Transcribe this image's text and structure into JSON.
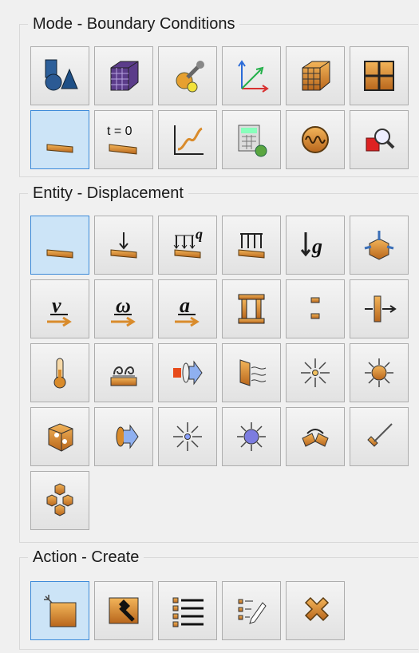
{
  "mode_group": {
    "title": "Mode - Boundary Conditions",
    "buttons": [
      {
        "icon": "geometry-shapes-icon"
      },
      {
        "icon": "mesh-cube-icon"
      },
      {
        "icon": "tools-properties-icon"
      },
      {
        "icon": "coordinate-system-icon"
      },
      {
        "icon": "mesh-grid-cube-icon"
      },
      {
        "icon": "panel-grid-icon"
      },
      {
        "icon": "boundary-conditions-icon",
        "selected": true
      },
      {
        "icon": "initial-conditions-icon",
        "label": "t = 0"
      },
      {
        "icon": "curve-plot-icon"
      },
      {
        "icon": "calculator-gear-icon"
      },
      {
        "icon": "vibration-wave-icon"
      },
      {
        "icon": "inspect-magnifier-icon"
      }
    ]
  },
  "entity_group": {
    "title": "Entity - Displacement",
    "buttons": [
      {
        "icon": "displacement-icon",
        "selected": true
      },
      {
        "icon": "force-icon"
      },
      {
        "icon": "pressure-q-icon",
        "label": "q"
      },
      {
        "icon": "distributed-load-icon"
      },
      {
        "icon": "gravity-icon",
        "label": "g"
      },
      {
        "icon": "cube-constraint-icon"
      },
      {
        "icon": "velocity-icon",
        "label": "v"
      },
      {
        "icon": "angular-velocity-icon",
        "label": "ω"
      },
      {
        "icon": "acceleration-icon",
        "label": "a"
      },
      {
        "icon": "beam-columns-icon"
      },
      {
        "icon": "connector-icon"
      },
      {
        "icon": "rigid-link-icon"
      },
      {
        "icon": "thermometer-icon"
      },
      {
        "icon": "convection-icon"
      },
      {
        "icon": "heat-flux-icon"
      },
      {
        "icon": "radiation-surface-icon"
      },
      {
        "icon": "point-source-icon"
      },
      {
        "icon": "heat-source-icon"
      },
      {
        "icon": "volumetric-heat-icon"
      },
      {
        "icon": "surface-heat-flux-icon"
      },
      {
        "icon": "point-source-small-icon"
      },
      {
        "icon": "nodal-heat-icon"
      },
      {
        "icon": "hinge-joint-icon"
      },
      {
        "icon": "slider-bar-icon"
      },
      {
        "icon": "assembly-cubes-icon"
      }
    ]
  },
  "action_group": {
    "title": "Action - Create",
    "buttons": [
      {
        "icon": "create-new-icon",
        "selected": true
      },
      {
        "icon": "modify-hammer-icon"
      },
      {
        "icon": "list-icon"
      },
      {
        "icon": "edit-list-icon"
      },
      {
        "icon": "delete-x-icon"
      }
    ]
  },
  "colors": {
    "accent": "#3c8ad9",
    "selected_bg": "#cce4f7",
    "orange": "#d98b2b"
  }
}
